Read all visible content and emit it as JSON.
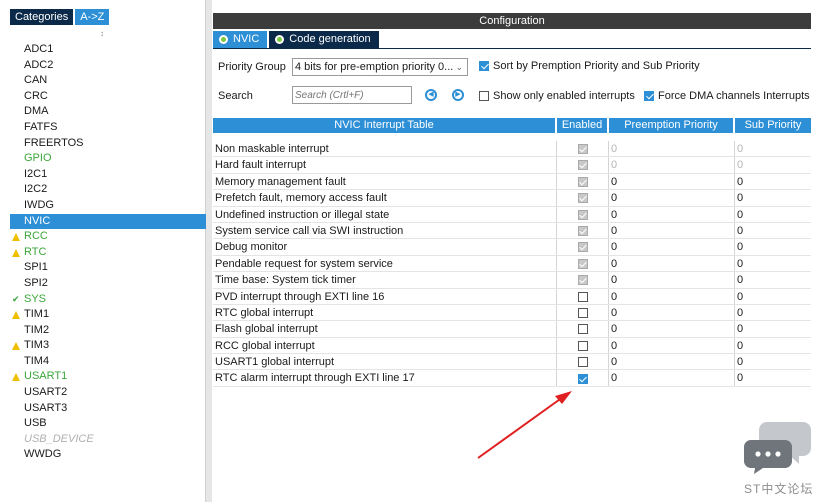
{
  "left_panel": {
    "tabs": [
      "Categories",
      "A->Z"
    ],
    "sort_arrow": "↕",
    "items": [
      {
        "label": "ADC1",
        "state": "normal"
      },
      {
        "label": "ADC2",
        "state": "normal"
      },
      {
        "label": "CAN",
        "state": "normal"
      },
      {
        "label": "CRC",
        "state": "normal"
      },
      {
        "label": "DMA",
        "state": "normal"
      },
      {
        "label": "FATFS",
        "state": "normal"
      },
      {
        "label": "FREERTOS",
        "state": "normal"
      },
      {
        "label": "GPIO",
        "state": "green"
      },
      {
        "label": "I2C1",
        "state": "normal"
      },
      {
        "label": "I2C2",
        "state": "normal"
      },
      {
        "label": "IWDG",
        "state": "normal"
      },
      {
        "label": "NVIC",
        "state": "selected"
      },
      {
        "label": "RCC",
        "state": "warn"
      },
      {
        "label": "RTC",
        "state": "warn"
      },
      {
        "label": "SPI1",
        "state": "normal"
      },
      {
        "label": "SPI2",
        "state": "normal"
      },
      {
        "label": "SYS",
        "state": "ok"
      },
      {
        "label": "TIM1",
        "state": "warn-plain"
      },
      {
        "label": "TIM2",
        "state": "normal"
      },
      {
        "label": "TIM3",
        "state": "warn-plain"
      },
      {
        "label": "TIM4",
        "state": "normal"
      },
      {
        "label": "USART1",
        "state": "warn"
      },
      {
        "label": "USART2",
        "state": "normal"
      },
      {
        "label": "USART3",
        "state": "normal"
      },
      {
        "label": "USB",
        "state": "normal"
      },
      {
        "label": "USB_DEVICE",
        "state": "disabled"
      },
      {
        "label": "WWDG",
        "state": "normal"
      }
    ]
  },
  "config": {
    "title": "Configuration",
    "tabs": [
      "NVIC",
      "Code generation"
    ],
    "priority_group_label": "Priority Group",
    "priority_group_value": "4 bits for pre-emption priority 0...",
    "sort_label": "Sort by Premption Priority and Sub Priority",
    "search_label": "Search",
    "search_placeholder": "Search (Crtl+F)",
    "show_enabled_label": "Show only enabled interrupts",
    "force_dma_label": "Force DMA channels Interrupts"
  },
  "table": {
    "headers": [
      "NVIC Interrupt Table",
      "Enabled",
      "Preemption Priority",
      "Sub Priority"
    ],
    "rows": [
      {
        "name": "Non maskable interrupt",
        "enabled": "fixed",
        "pre": "0",
        "sub": "0",
        "fixed": true
      },
      {
        "name": "Hard fault interrupt",
        "enabled": "fixed",
        "pre": "0",
        "sub": "0",
        "fixed": true
      },
      {
        "name": "Memory management fault",
        "enabled": "fixed",
        "pre": "0",
        "sub": "0",
        "fixed": false
      },
      {
        "name": "Prefetch fault, memory access fault",
        "enabled": "fixed",
        "pre": "0",
        "sub": "0",
        "fixed": false
      },
      {
        "name": "Undefined instruction or illegal state",
        "enabled": "fixed",
        "pre": "0",
        "sub": "0",
        "fixed": false
      },
      {
        "name": "System service call via SWI instruction",
        "enabled": "fixed",
        "pre": "0",
        "sub": "0",
        "fixed": false
      },
      {
        "name": "Debug monitor",
        "enabled": "fixed",
        "pre": "0",
        "sub": "0",
        "fixed": false
      },
      {
        "name": "Pendable request for system service",
        "enabled": "fixed",
        "pre": "0",
        "sub": "0",
        "fixed": false
      },
      {
        "name": "Time base: System tick timer",
        "enabled": "fixed",
        "pre": "0",
        "sub": "0",
        "fixed": false
      },
      {
        "name": "PVD interrupt through EXTI line 16",
        "enabled": "off",
        "pre": "0",
        "sub": "0",
        "fixed": false
      },
      {
        "name": "RTC global interrupt",
        "enabled": "off",
        "pre": "0",
        "sub": "0",
        "fixed": false
      },
      {
        "name": "Flash global interrupt",
        "enabled": "off",
        "pre": "0",
        "sub": "0",
        "fixed": false
      },
      {
        "name": "RCC global interrupt",
        "enabled": "off",
        "pre": "0",
        "sub": "0",
        "fixed": false
      },
      {
        "name": "USART1 global interrupt",
        "enabled": "off",
        "pre": "0",
        "sub": "0",
        "fixed": false
      },
      {
        "name": "RTC alarm interrupt through EXTI line 17",
        "enabled": "on",
        "pre": "0",
        "sub": "0",
        "fixed": false
      }
    ]
  },
  "watermark": {
    "text": "ST中文论坛",
    "icon": "chat-bubbles-icon"
  },
  "colors": {
    "accent": "#2d8fd6",
    "dark_tab": "#0b2a4a",
    "config_bar": "#3c3c3c",
    "ok_green": "#3aa63a",
    "warn_yellow": "#f0c000",
    "arrow_red": "#e02020"
  }
}
